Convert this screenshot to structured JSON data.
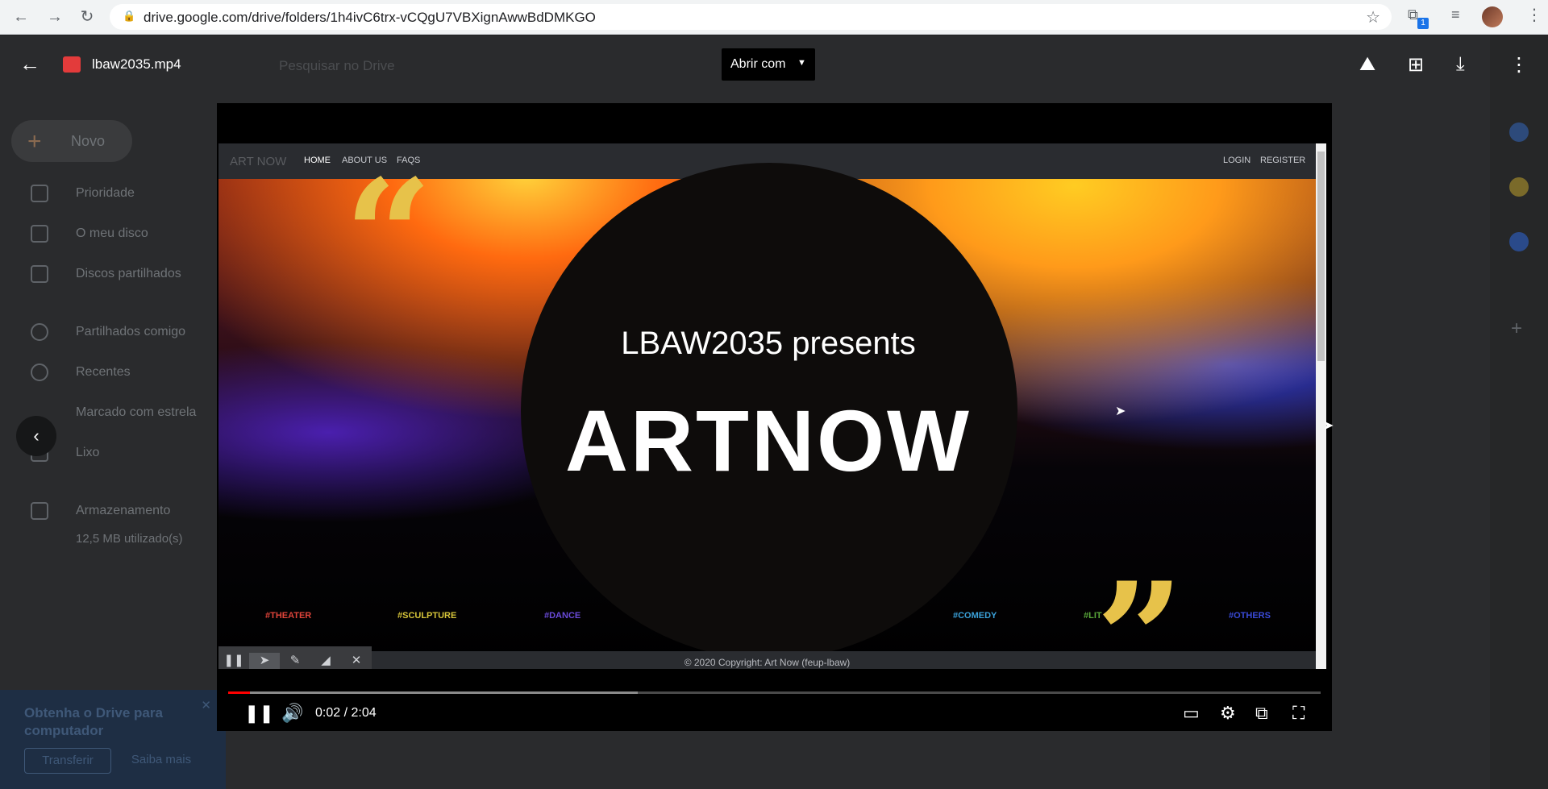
{
  "browser": {
    "url": "drive.google.com/drive/folders/1h4ivC6trx-vCQgU7VBXignAwwBdDMKGO",
    "extension_badge": "1"
  },
  "drive": {
    "search_placeholder": "Pesquisar no Drive",
    "new_button": "Novo",
    "sidebar": [
      {
        "label": "Prioridade",
        "icon": "check-square-icon"
      },
      {
        "label": "O meu disco",
        "icon": "drive-icon"
      },
      {
        "label": "Discos partilhados",
        "icon": "shared-drive-icon"
      },
      {
        "label": "Partilhados comigo",
        "icon": "people-icon"
      },
      {
        "label": "Recentes",
        "icon": "clock-icon"
      },
      {
        "label": "Marcado com estrela",
        "icon": "star-icon"
      },
      {
        "label": "Lixo",
        "icon": "trash-icon"
      },
      {
        "label": "Armazenamento",
        "icon": "storage-icon"
      }
    ],
    "storage_used": "12,5 MB utilizado(s)",
    "promo": {
      "text": "Obtenha o Drive para computador",
      "download": "Transferir",
      "learn_more": "Saiba mais"
    }
  },
  "viewer": {
    "file_name": "lbaw2035.mp4",
    "open_with": "Abrir com"
  },
  "video_frame": {
    "brand": "ART NOW",
    "nav": [
      "HOME",
      "ABOUT US",
      "FAQS"
    ],
    "auth": [
      "LOGIN",
      "REGISTER"
    ],
    "presents": "LBAW2035 presents",
    "title": "ARTNOW",
    "tags": [
      {
        "text": "#THEATER",
        "color": "#e0443a"
      },
      {
        "text": "#SCULPTURE",
        "color": "#d6c43a"
      },
      {
        "text": "#DANCE",
        "color": "#6a4ad8"
      },
      {
        "text": "#COMEDY",
        "color": "#3aa0d8"
      },
      {
        "text": "#LIT",
        "color": "#5aa83a"
      },
      {
        "text": "#OTHERS",
        "color": "#3a4ad8"
      }
    ],
    "copyright": "© 2020 Copyright: Art Now (feup-lbaw)"
  },
  "player": {
    "time": "0:02 / 2:04",
    "played_fraction": 0.02,
    "buffered_fraction": 0.375
  }
}
